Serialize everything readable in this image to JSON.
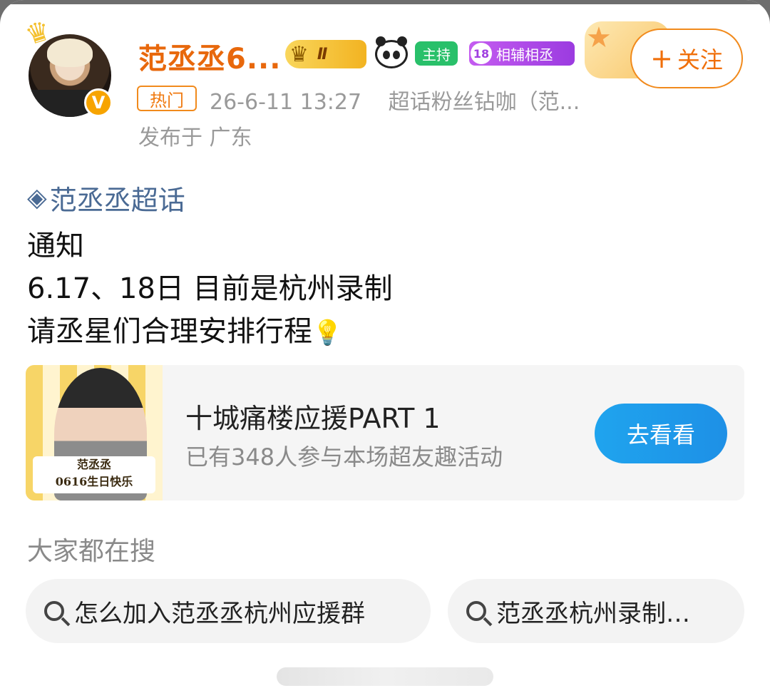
{
  "post": {
    "username": "范丞丞6...",
    "level_badge": "Ⅱ",
    "host_badge": "主持",
    "fan_level": "18",
    "fan_badge": "相辅相丞",
    "follow_label": "关注",
    "verified": "V",
    "hot_tag": "热门",
    "timestamp": "26-6-11 13:27",
    "source": "超话粉丝钻咖（范...",
    "location": "发布于 广东"
  },
  "content": {
    "topic": "范丞丞超话",
    "lines": [
      "通知",
      "6.17、18日 目前是杭州录制",
      "请丞星们合理安排行程"
    ]
  },
  "activity": {
    "title": "十城痛楼应援PART 1",
    "subtitle": "已有348人参与本场超友趣活动",
    "button": "去看看",
    "thumb_caption_1": "范丞丞",
    "thumb_caption_2": "0616生日快乐"
  },
  "search": {
    "heading": "大家都在搜",
    "chips": [
      "怎么加入范丞丞杭州应援群",
      "范丞丞杭州录制…"
    ]
  },
  "colors": {
    "accent_orange": "#f06f0a",
    "topic_blue": "#4a6a94",
    "button_blue": "#1e90e6"
  }
}
